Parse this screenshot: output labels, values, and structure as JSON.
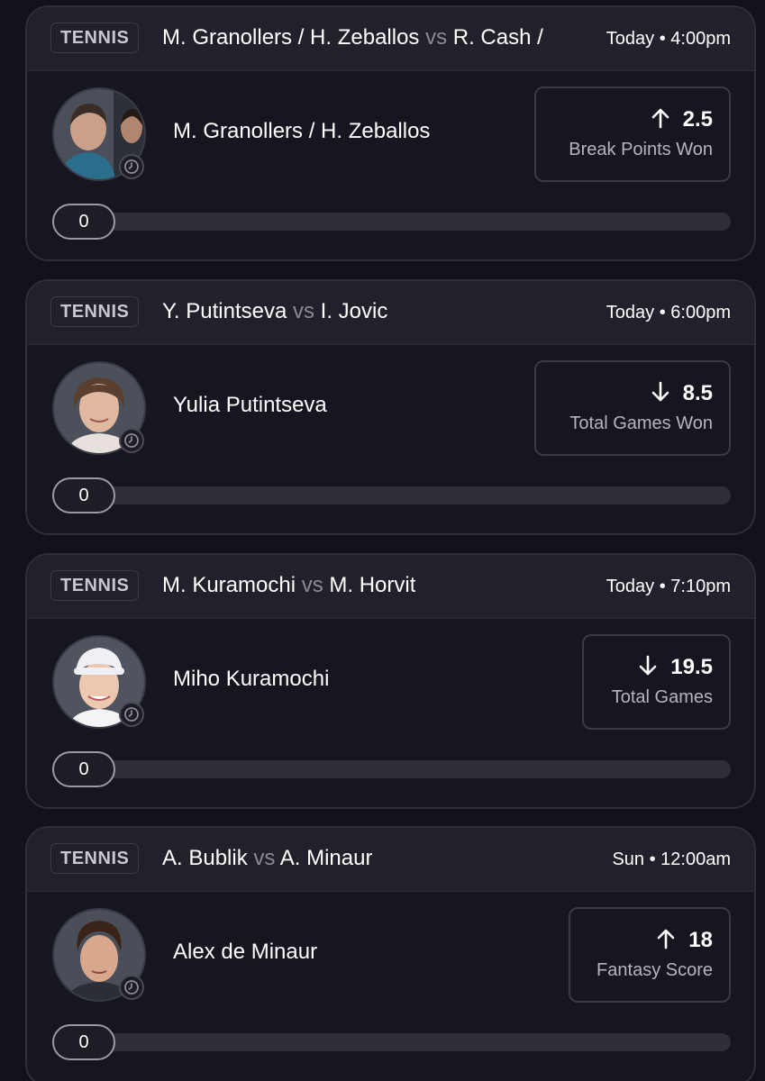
{
  "cards": [
    {
      "sport": "TENNIS",
      "matchup_a": "M. Granollers / H. Zeballos",
      "vs": "vs",
      "matchup_b": "R. Cash /",
      "time": "Today • 4:00pm",
      "player": "M. Granollers / H. Zeballos",
      "direction": "up",
      "line": "2.5",
      "stat": "Break Points Won",
      "progress": "0"
    },
    {
      "sport": "TENNIS",
      "matchup_a": "Y. Putintseva",
      "vs": "vs",
      "matchup_b": "I. Jovic",
      "time": "Today • 6:00pm",
      "player": "Yulia Putintseva",
      "direction": "down",
      "line": "8.5",
      "stat": "Total Games Won",
      "progress": "0"
    },
    {
      "sport": "TENNIS",
      "matchup_a": "M. Kuramochi",
      "vs": "vs",
      "matchup_b": "M. Horvit",
      "time": "Today • 7:10pm",
      "player": "Miho Kuramochi",
      "direction": "down",
      "line": "19.5",
      "stat": "Total Games",
      "progress": "0"
    },
    {
      "sport": "TENNIS",
      "matchup_a": "A. Bublik",
      "vs": "vs",
      "matchup_b": "A. Minaur",
      "time": "Sun • 12:00am",
      "player": "Alex de Minaur",
      "direction": "up",
      "line": "18",
      "stat": "Fantasy Score",
      "progress": "0"
    }
  ],
  "icons": {
    "up": "arrow-up-icon",
    "down": "arrow-down-icon",
    "clock": "clock-icon"
  },
  "colors": {
    "background": "#12121a",
    "card": "#161620",
    "header": "#21212b",
    "muted": "#8a8a96"
  }
}
